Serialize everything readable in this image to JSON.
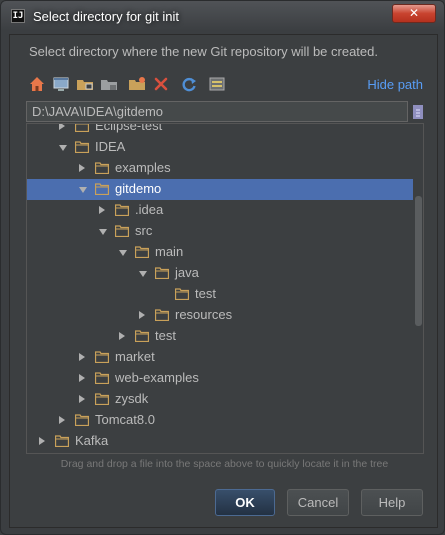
{
  "window": {
    "title": "Select directory for git init",
    "app_icon": "IJ",
    "close_symbol": "✕"
  },
  "description": "Select directory where the new Git repository will be created.",
  "toolbar": {
    "buttons": [
      "home-icon",
      "desktop-icon",
      "project-folder-icon",
      "module-folder-icon",
      "new-folder-icon",
      "delete-icon",
      "refresh-icon",
      "show-hidden-icon"
    ],
    "hide_path_label": "Hide path"
  },
  "path": {
    "value": "D:\\JAVA\\IDEA\\gitdemo"
  },
  "tree": {
    "items": [
      {
        "label": "Eclipse-test",
        "depth": 2,
        "expanded": false,
        "selected": false
      },
      {
        "label": "IDEA",
        "depth": 2,
        "expanded": true,
        "selected": false
      },
      {
        "label": "examples",
        "depth": 3,
        "expanded": false,
        "selected": false
      },
      {
        "label": "gitdemo",
        "depth": 3,
        "expanded": true,
        "selected": true
      },
      {
        "label": ".idea",
        "depth": 4,
        "expanded": false,
        "selected": false
      },
      {
        "label": "src",
        "depth": 4,
        "expanded": true,
        "selected": false
      },
      {
        "label": "main",
        "depth": 5,
        "expanded": true,
        "selected": false
      },
      {
        "label": "java",
        "depth": 6,
        "expanded": true,
        "selected": false
      },
      {
        "label": "test",
        "depth": 7,
        "expanded": null,
        "selected": false
      },
      {
        "label": "resources",
        "depth": 6,
        "expanded": false,
        "selected": false
      },
      {
        "label": "test",
        "depth": 5,
        "expanded": false,
        "selected": false
      },
      {
        "label": "market",
        "depth": 3,
        "expanded": false,
        "selected": false
      },
      {
        "label": "web-examples",
        "depth": 3,
        "expanded": false,
        "selected": false
      },
      {
        "label": "zysdk",
        "depth": 3,
        "expanded": false,
        "selected": false
      },
      {
        "label": "Tomcat8.0",
        "depth": 2,
        "expanded": false,
        "selected": false
      },
      {
        "label": "Kafka",
        "depth": 1,
        "expanded": false,
        "selected": false
      }
    ]
  },
  "hint": "Drag and drop a file into the space above to quickly locate it in the tree",
  "buttons": {
    "ok": "OK",
    "cancel": "Cancel",
    "help": "Help"
  },
  "colors": {
    "background": "#3c3f41",
    "selection": "#4b6eaf",
    "link": "#589df6",
    "folder": "#c9a15a"
  }
}
